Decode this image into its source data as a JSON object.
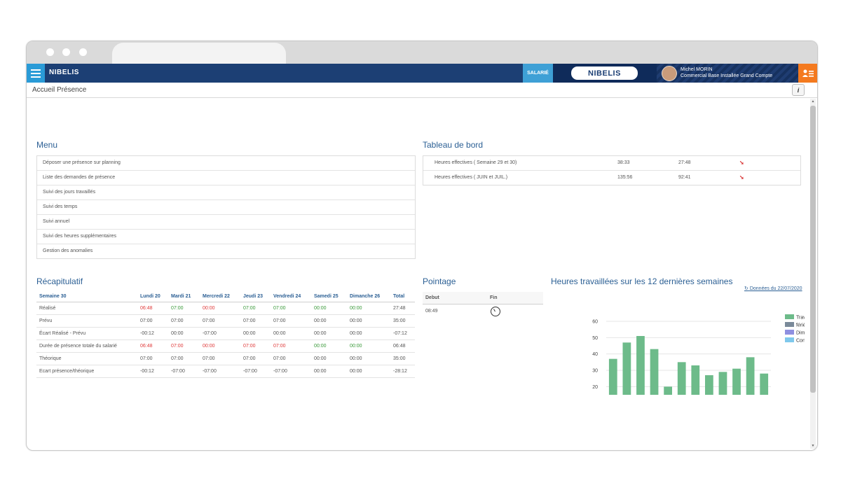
{
  "app": {
    "brand_small": "NIBELIS",
    "brand_center": "NIBELIS",
    "role_label": "SALARIÉ",
    "user_name": "Michel MORIN",
    "user_role": "Commercial Base Installée Grand Compte",
    "breadcrumb": "Accueil Présence",
    "info_label": "i"
  },
  "menu": {
    "title": "Menu",
    "items": [
      "Déposer une présence sur planning",
      "Liste des demandes de présence",
      "Suivi des jours travaillés",
      "Suivi des temps",
      "Suivi annuel",
      "Suivi des heures supplémentaires",
      "Gestion des anomalies"
    ]
  },
  "dashboard": {
    "title": "Tableau de bord",
    "rows": [
      {
        "label": "Heures effectives ( Semaine 29 et 30)",
        "v1": "38:33",
        "v2": "27:48"
      },
      {
        "label": "Heures effectives ( JUIN et JUIL.)",
        "v1": "135:56",
        "v2": "92:41"
      }
    ],
    "trend_icon": "down-arrow-icon"
  },
  "recap": {
    "title": "Récapitulatif",
    "headers": [
      "Semaine 30",
      "Lundi 20",
      "Mardi 21",
      "Mercredi 22",
      "Jeudi 23",
      "Vendredi 24",
      "Samedi 25",
      "Dimanche 26",
      "Total"
    ],
    "rows": [
      {
        "cells": [
          "Réalisé",
          "06:48",
          "07:00",
          "00:00",
          "07:00",
          "07:00",
          "00:00",
          "00:00",
          "27:48"
        ],
        "colors": [
          "",
          "red",
          "green",
          "red",
          "green",
          "green",
          "green",
          "green",
          ""
        ]
      },
      {
        "cells": [
          "Prévu",
          "07:00",
          "07:00",
          "07:00",
          "07:00",
          "07:00",
          "00:00",
          "00:00",
          "35:00"
        ],
        "colors": [
          "",
          "",
          "",
          "",
          "",
          "",
          "",
          "",
          ""
        ]
      },
      {
        "cells": [
          "Écart Réalisé - Prévu",
          "-00:12",
          "00:00",
          "-07:00",
          "00:00",
          "00:00",
          "00:00",
          "00:00",
          "-07:12"
        ],
        "colors": [
          "",
          "",
          "",
          "",
          "",
          "",
          "",
          "",
          ""
        ]
      },
      {
        "cells": [
          "Durée de présence totale du salarié",
          "06:48",
          "07:00",
          "00:00",
          "07:00",
          "07:00",
          "00:00",
          "00:00",
          "06:48"
        ],
        "colors": [
          "",
          "red",
          "red",
          "red",
          "red",
          "red",
          "green",
          "green",
          ""
        ]
      },
      {
        "cells": [
          "Théorique",
          "07:00",
          "07:00",
          "07:00",
          "07:00",
          "07:00",
          "00:00",
          "00:00",
          "35:00"
        ],
        "colors": [
          "",
          "",
          "",
          "",
          "",
          "",
          "",
          "",
          ""
        ]
      },
      {
        "cells": [
          "Ecart présence/théorique",
          "-00:12",
          "-07:00",
          "-07:00",
          "-07:00",
          "-07:00",
          "00:00",
          "00:00",
          "-28:12"
        ],
        "colors": [
          "",
          "",
          "",
          "",
          "",
          "",
          "",
          "",
          ""
        ]
      }
    ],
    "colors": {
      "red": "#e03a3a",
      "green": "#3a9a3a"
    }
  },
  "pointage": {
    "title": "Pointage",
    "col_debut": "Debut",
    "col_fin": "Fin",
    "debut_value": "08:49",
    "fin_icon": "clock-icon"
  },
  "hours_chart": {
    "title": "Heures travaillées sur les 12 dernières semaines",
    "refresh_label": "Données du 22/07/2020",
    "refresh_icon": "refresh-icon"
  },
  "chart_data": {
    "type": "bar",
    "ylim": [
      15,
      60
    ],
    "yticks": [
      20,
      30,
      40,
      50,
      60
    ],
    "values": [
      37,
      47,
      51,
      43,
      20,
      35,
      33,
      27,
      29,
      31,
      38,
      28
    ],
    "legend": [
      {
        "name": "Travaillées",
        "color": "#6dbb8a"
      },
      {
        "name": "fériés",
        "color": "#7a8a9a"
      },
      {
        "name": "Dimanche",
        "color": "#8e8fe0"
      },
      {
        "name": "Congés",
        "color": "#7fc8ec"
      }
    ],
    "legend_position": "top-right",
    "grid": true
  }
}
